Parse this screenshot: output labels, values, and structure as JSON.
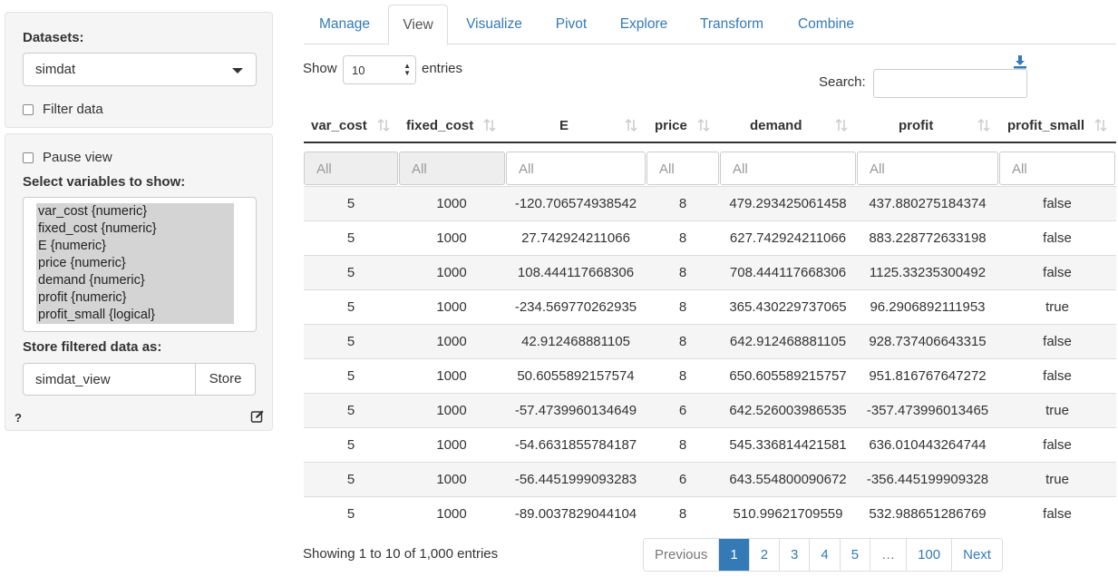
{
  "sidebar": {
    "datasets_label": "Datasets:",
    "dataset_selected": "simdat",
    "filter_label": "Filter data",
    "pause_label": "Pause view",
    "select_vars_label": "Select variables to show:",
    "variables": [
      "var_cost {numeric}",
      "fixed_cost {numeric}",
      "E {numeric}",
      "price {numeric}",
      "demand {numeric}",
      "profit {numeric}",
      "profit_small {logical}"
    ],
    "store_label": "Store filtered data as:",
    "store_value": "simdat_view",
    "store_button": "Store",
    "help": "?"
  },
  "tabs": [
    "Manage",
    "View",
    "Visualize",
    "Pivot",
    "Explore",
    "Transform",
    "Combine"
  ],
  "active_tab": "View",
  "controls": {
    "show_label": "Show",
    "length_value": "10",
    "entries_label": "entries",
    "search_label": "Search:"
  },
  "table": {
    "columns": [
      "var_cost",
      "fixed_cost",
      "E",
      "price",
      "demand",
      "profit",
      "profit_small"
    ],
    "filter_placeholder": "All",
    "rows": [
      [
        "5",
        "1000",
        "-120.706574938542",
        "8",
        "479.293425061458",
        "437.880275184374",
        "false"
      ],
      [
        "5",
        "1000",
        "27.742924211066",
        "8",
        "627.742924211066",
        "883.228772633198",
        "false"
      ],
      [
        "5",
        "1000",
        "108.444117668306",
        "8",
        "708.444117668306",
        "1125.33235300492",
        "false"
      ],
      [
        "5",
        "1000",
        "-234.569770262935",
        "8",
        "365.430229737065",
        "96.2906892111953",
        "true"
      ],
      [
        "5",
        "1000",
        "42.912468881105",
        "8",
        "642.912468881105",
        "928.737406643315",
        "false"
      ],
      [
        "5",
        "1000",
        "50.6055892157574",
        "8",
        "650.605589215757",
        "951.816767647272",
        "false"
      ],
      [
        "5",
        "1000",
        "-57.4739960134649",
        "6",
        "642.526003986535",
        "-357.473996013465",
        "true"
      ],
      [
        "5",
        "1000",
        "-54.6631855784187",
        "8",
        "545.336814421581",
        "636.010443264744",
        "false"
      ],
      [
        "5",
        "1000",
        "-56.4451999093283",
        "6",
        "643.554800090672",
        "-356.445199909328",
        "true"
      ],
      [
        "5",
        "1000",
        "-89.0037829044104",
        "8",
        "510.99621709559",
        "532.988651286769",
        "false"
      ]
    ]
  },
  "footer": {
    "info": "Showing 1 to 10 of 1,000 entries",
    "pagination": [
      "Previous",
      "1",
      "2",
      "3",
      "4",
      "5",
      "…",
      "100",
      "Next"
    ],
    "current_page": "1"
  },
  "colors": {
    "accent": "#337ab7",
    "stripe": "#f5f5f5",
    "well": "#f5f5f5",
    "selected_option": "#d4d4d4"
  }
}
